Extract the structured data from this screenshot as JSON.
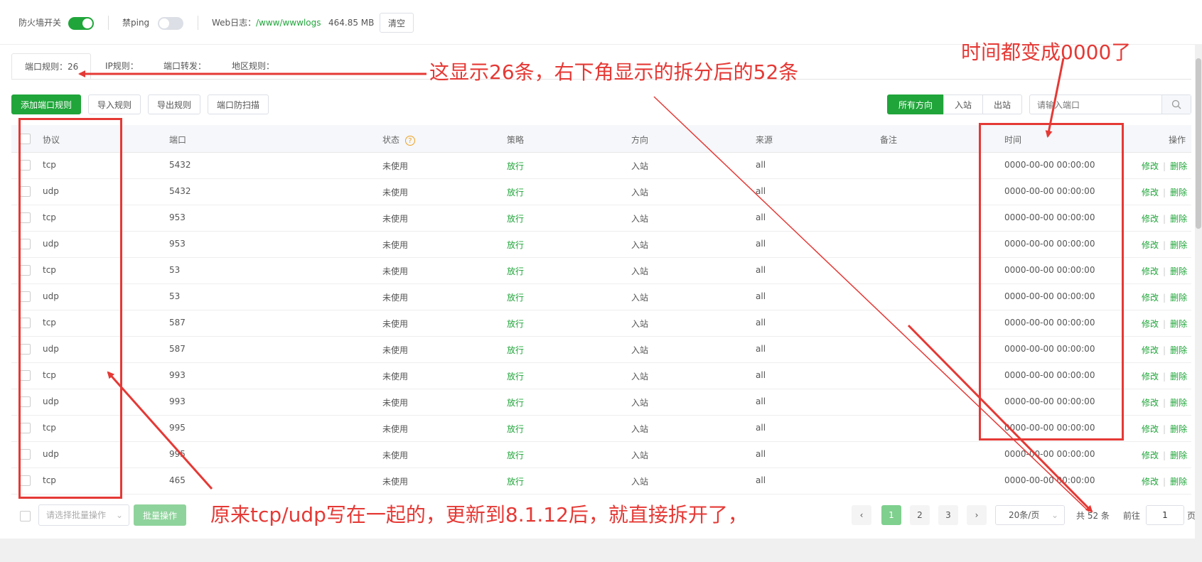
{
  "topbar": {
    "firewall_label": "防火墙开关",
    "ping_label": "禁ping",
    "weblog_label": "Web日志：",
    "weblog_path": "/www/wwwlogs",
    "weblog_size": "464.85 MB",
    "clear_button": "清空"
  },
  "tabs": [
    {
      "label": "端口规则：26"
    },
    {
      "label": "IP规则："
    },
    {
      "label": "端口转发："
    },
    {
      "label": "地区规则："
    }
  ],
  "toolbar": {
    "add_button": "添加端口规则",
    "import_button": "导入规则",
    "export_button": "导出规则",
    "scan_button": "端口防扫描",
    "dir_all": "所有方向",
    "dir_in": "入站",
    "dir_out": "出站",
    "search_placeholder": "请输入端口"
  },
  "table": {
    "headers": {
      "protocol": "协议",
      "port": "端口",
      "status": "状态",
      "policy": "策略",
      "direction": "方向",
      "source": "来源",
      "remark": "备注",
      "time": "时间",
      "actions": "操作"
    },
    "rows": [
      {
        "protocol": "tcp",
        "port": "5432",
        "status": "未使用",
        "policy": "放行",
        "direction": "入站",
        "source": "all",
        "time": "0000-00-00 00:00:00",
        "edit": "修改",
        "delete": "删除"
      },
      {
        "protocol": "udp",
        "port": "5432",
        "status": "未使用",
        "policy": "放行",
        "direction": "入站",
        "source": "all",
        "time": "0000-00-00 00:00:00",
        "edit": "修改",
        "delete": "删除"
      },
      {
        "protocol": "tcp",
        "port": "953",
        "status": "未使用",
        "policy": "放行",
        "direction": "入站",
        "source": "all",
        "time": "0000-00-00 00:00:00",
        "edit": "修改",
        "delete": "删除"
      },
      {
        "protocol": "udp",
        "port": "953",
        "status": "未使用",
        "policy": "放行",
        "direction": "入站",
        "source": "all",
        "time": "0000-00-00 00:00:00",
        "edit": "修改",
        "delete": "删除"
      },
      {
        "protocol": "tcp",
        "port": "53",
        "status": "未使用",
        "policy": "放行",
        "direction": "入站",
        "source": "all",
        "time": "0000-00-00 00:00:00",
        "edit": "修改",
        "delete": "删除"
      },
      {
        "protocol": "udp",
        "port": "53",
        "status": "未使用",
        "policy": "放行",
        "direction": "入站",
        "source": "all",
        "time": "0000-00-00 00:00:00",
        "edit": "修改",
        "delete": "删除"
      },
      {
        "protocol": "tcp",
        "port": "587",
        "status": "未使用",
        "policy": "放行",
        "direction": "入站",
        "source": "all",
        "time": "0000-00-00 00:00:00",
        "edit": "修改",
        "delete": "删除"
      },
      {
        "protocol": "udp",
        "port": "587",
        "status": "未使用",
        "policy": "放行",
        "direction": "入站",
        "source": "all",
        "time": "0000-00-00 00:00:00",
        "edit": "修改",
        "delete": "删除"
      },
      {
        "protocol": "tcp",
        "port": "993",
        "status": "未使用",
        "policy": "放行",
        "direction": "入站",
        "source": "all",
        "time": "0000-00-00 00:00:00",
        "edit": "修改",
        "delete": "删除"
      },
      {
        "protocol": "udp",
        "port": "993",
        "status": "未使用",
        "policy": "放行",
        "direction": "入站",
        "source": "all",
        "time": "0000-00-00 00:00:00",
        "edit": "修改",
        "delete": "删除"
      },
      {
        "protocol": "tcp",
        "port": "995",
        "status": "未使用",
        "policy": "放行",
        "direction": "入站",
        "source": "all",
        "time": "0000-00-00 00:00:00",
        "edit": "修改",
        "delete": "删除"
      },
      {
        "protocol": "udp",
        "port": "995",
        "status": "未使用",
        "policy": "放行",
        "direction": "入站",
        "source": "all",
        "time": "0000-00-00 00:00:00",
        "edit": "修改",
        "delete": "删除"
      },
      {
        "protocol": "tcp",
        "port": "465",
        "status": "未使用",
        "policy": "放行",
        "direction": "入站",
        "source": "all",
        "time": "0000-00-00 00:00:00",
        "edit": "修改",
        "delete": "删除"
      }
    ]
  },
  "footer": {
    "batch_select_placeholder": "请选择批量操作",
    "batch_button": "批量操作",
    "pages": [
      "1",
      "2",
      "3"
    ],
    "page_size": "20条/页",
    "total": "共 52 条",
    "goto_label": "前往",
    "goto_value": "1",
    "page_unit": "页"
  },
  "annotations": {
    "top_note": "这显示26条，右下角显示的拆分后的52条",
    "time_note": "时间都变成0000了",
    "bottom_note": "原来tcp/udp写在一起的，更新到8.1.12后，就直接拆开了，"
  },
  "colors": {
    "brand_green": "#20a53a",
    "annotation_red": "#e53935"
  }
}
